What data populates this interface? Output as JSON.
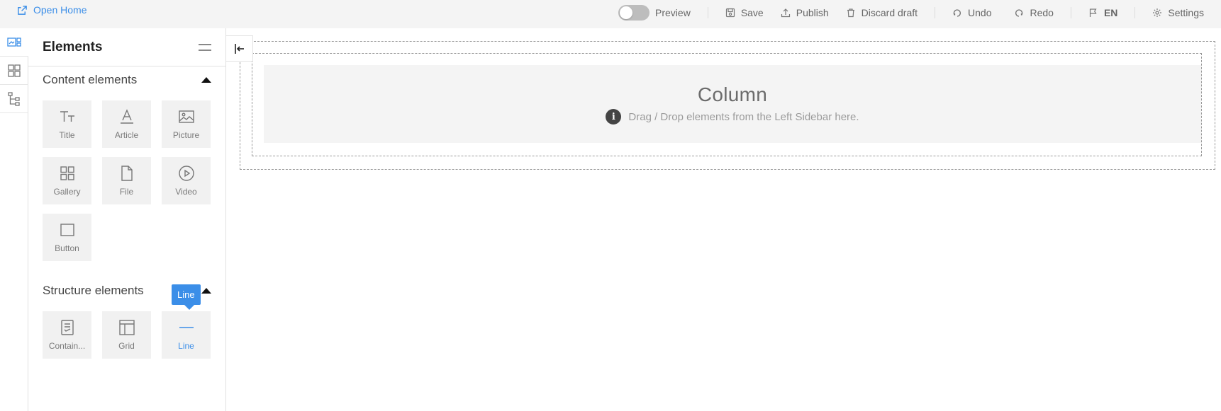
{
  "topbar": {
    "open_home": "Open Home",
    "preview": "Preview",
    "save": "Save",
    "publish": "Publish",
    "discard": "Discard draft",
    "undo": "Undo",
    "redo": "Redo",
    "language": "EN",
    "settings": "Settings"
  },
  "panel": {
    "title": "Elements",
    "content_section": {
      "title": "Content elements",
      "items": [
        {
          "label": "Title",
          "icon": "text-title-icon"
        },
        {
          "label": "Article",
          "icon": "article-icon"
        },
        {
          "label": "Picture",
          "icon": "picture-icon"
        },
        {
          "label": "Gallery",
          "icon": "gallery-icon"
        },
        {
          "label": "File",
          "icon": "file-icon"
        },
        {
          "label": "Video",
          "icon": "video-icon"
        },
        {
          "label": "Button",
          "icon": "button-icon"
        }
      ]
    },
    "structure_section": {
      "title": "Structure elements",
      "items": [
        {
          "label": "Contain...",
          "icon": "container-icon"
        },
        {
          "label": "Grid",
          "icon": "grid-icon"
        },
        {
          "label": "Line",
          "icon": "line-icon"
        }
      ]
    },
    "tooltip": "Line"
  },
  "canvas": {
    "column_title": "Column",
    "column_hint": "Drag / Drop elements from the Left Sidebar here.",
    "info_glyph": "i"
  },
  "colors": {
    "accent": "#3b8ee8",
    "tile_bg": "#f1f1f1",
    "column_bg": "#f4f4f4"
  }
}
